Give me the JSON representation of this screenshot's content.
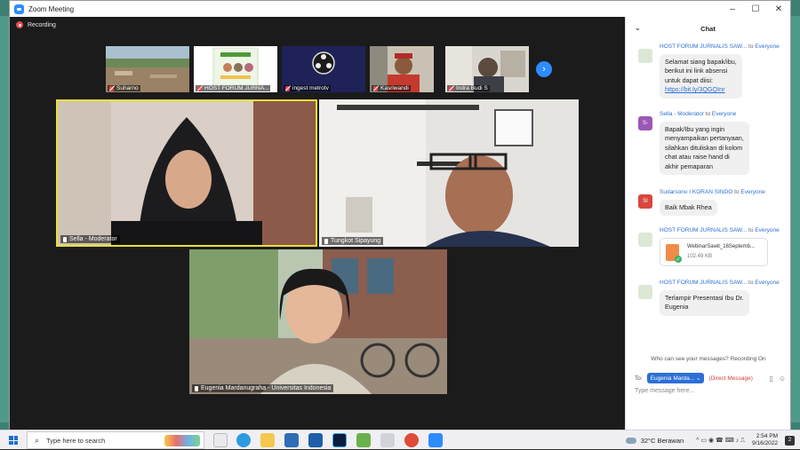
{
  "window": {
    "title": "Zoom Meeting",
    "controls": [
      "–",
      "☐",
      "✕"
    ]
  },
  "meeting": {
    "recording_label": "Recording",
    "thumbnails": [
      {
        "name": "Suharno"
      },
      {
        "name": "HOST FORUM JURNA..."
      },
      {
        "name": "ingest metrotv"
      },
      {
        "name": "Kasriwandi"
      },
      {
        "name": "Indra Budi S"
      }
    ],
    "next_icon": "›",
    "tiles": [
      {
        "name": "Sella - Moderator"
      },
      {
        "name": "Tungkot Sipayung"
      },
      {
        "name": "Eugenia Mardanugraha - Universitas Indonesia"
      }
    ]
  },
  "chat": {
    "title": "Chat",
    "collapse_icon": "⌄",
    "messages": [
      {
        "sender": "HOST FORUM JURNALIS SAW...",
        "to": " to ",
        "target": "Everyone",
        "avatar": "",
        "avatar_color": "#dde7d5",
        "lines": [
          "Selamat siang bapak/ibu,",
          "berikut ini link absensi",
          "untuk dapat diisi:"
        ],
        "link": "https://bit.ly/3QGQInr"
      },
      {
        "sender": "Sella - Moderator",
        "to": " to ",
        "target": "Everyone",
        "avatar": "S-",
        "avatar_color": "#9b59b6",
        "lines": [
          "Bapak/Ibu yang ingin",
          "menyampaikan pertanyaan,",
          "silahkan dituliskan di kolom",
          "chat atau raise hand di",
          "akhir pemaparan"
        ]
      },
      {
        "sender": "Sudarsono I KORAN SINDO",
        "to": " to ",
        "target": "Everyone",
        "avatar": "SI",
        "avatar_color": "#d9473e",
        "lines": [
          "Baik Mbak Rhea"
        ]
      },
      {
        "sender": "HOST FORUM JURNALIS SAW...",
        "to": " to ",
        "target": "Everyone",
        "avatar": "",
        "avatar_color": "#dde7d5",
        "file_name": "WebinarSawit_16Septemb...",
        "file_size": "102.49 KB"
      },
      {
        "sender": "HOST FORUM JURNALIS SAW...",
        "to": " to ",
        "target": "Everyone",
        "avatar": "",
        "avatar_color": "#dde7d5",
        "lines": [
          "Terlampir Presentasi Ibu Dr.",
          "Eugenia"
        ]
      }
    ],
    "who_can_see": "Who can see your messages? Recording On",
    "to_label": "To:",
    "to_value": "Eugenia Marda... ⌄",
    "direct_message": "(Direct Message)",
    "placeholder": "Type message here..."
  },
  "taskbar": {
    "search_placeholder": "Type here to search",
    "search_icon": "⌕",
    "weather": "32°C  Berawan",
    "time": "2:54 PM",
    "date": "9/16/2022",
    "tray_icons": "^ ▭ ◉ ☎ ⌨ ♪ ⎍"
  }
}
